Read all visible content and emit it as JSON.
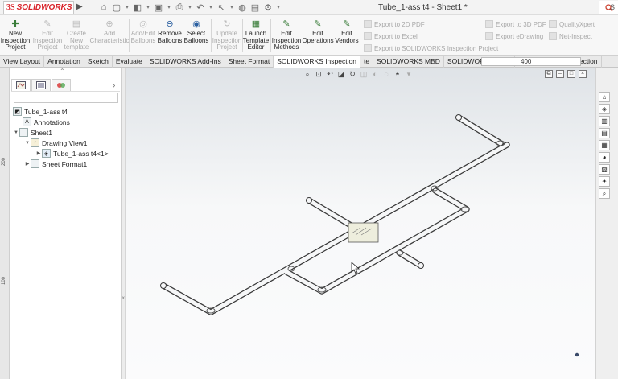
{
  "app": {
    "logo_prefix": "3S",
    "logo_name": "SOLIDWORKS",
    "document_title": "Tube_1-ass t4 - Sheet1 *",
    "right_label": "S"
  },
  "quick_access": {
    "icons": [
      "home-icon",
      "new-document-icon",
      "open-icon",
      "save-icon",
      "print-icon",
      "undo-icon",
      "select-icon",
      "rebuild-icon",
      "options-icon"
    ]
  },
  "ribbon": {
    "buttons": [
      {
        "label": "New Inspection Project",
        "lines": [
          "New",
          "Inspection",
          "Project"
        ],
        "enabled": true,
        "icon": "new-inspection-project-icon"
      },
      {
        "label": "Edit Inspection Project",
        "lines": [
          "Edit",
          "Inspection",
          "Project"
        ],
        "enabled": false,
        "icon": "edit-inspection-project-icon"
      },
      {
        "label": "Create New template",
        "lines": [
          "Create",
          "New",
          "template"
        ],
        "enabled": false,
        "icon": "create-template-icon"
      },
      {
        "label": "Add Characteristic",
        "lines": [
          "Add",
          "Characteristic"
        ],
        "enabled": false,
        "icon": "add-characteristic-icon"
      },
      {
        "label": "Add/Edit Balloons",
        "lines": [
          "Add/Edit",
          "Balloons"
        ],
        "enabled": false,
        "icon": "add-edit-balloons-icon"
      },
      {
        "label": "Remove Balloons",
        "lines": [
          "Remove",
          "Balloons"
        ],
        "enabled": true,
        "icon": "remove-balloons-icon"
      },
      {
        "label": "Select Balloons",
        "lines": [
          "Select",
          "Balloons"
        ],
        "enabled": true,
        "icon": "select-balloons-icon"
      },
      {
        "label": "Update Inspection Project",
        "lines": [
          "Update",
          "Inspection",
          "Project"
        ],
        "enabled": false,
        "icon": "update-inspection-project-icon"
      },
      {
        "label": "Launch Template Editor",
        "lines": [
          "Launch",
          "Template",
          "Editor"
        ],
        "enabled": true,
        "icon": "launch-template-editor-icon"
      },
      {
        "label": "Edit Inspection Methods",
        "lines": [
          "Edit",
          "Inspection",
          "Methods"
        ],
        "enabled": true,
        "icon": "edit-inspection-methods-icon"
      },
      {
        "label": "Edit Operations",
        "lines": [
          "Edit",
          "Operations"
        ],
        "enabled": true,
        "icon": "edit-operations-icon"
      },
      {
        "label": "Edit Vendors",
        "lines": [
          "Edit",
          "Vendors"
        ],
        "enabled": true,
        "icon": "edit-vendors-icon"
      }
    ],
    "export_items": [
      {
        "label": "Export to 2D PDF",
        "icon": "export-2d-pdf-icon"
      },
      {
        "label": "Export to Excel",
        "icon": "export-excel-icon"
      },
      {
        "label": "Export to SOLIDWORKS Inspection Project",
        "icon": "export-inspection-project-icon"
      },
      {
        "label": "Export to 3D PDF",
        "icon": "export-3d-pdf-icon"
      },
      {
        "label": "Export eDrawing",
        "icon": "export-edrawing-icon"
      },
      {
        "label": "QualityXpert",
        "icon": "qualityxpert-icon"
      },
      {
        "label": "Net-Inspect",
        "icon": "net-inspect-icon"
      }
    ]
  },
  "tabs": [
    {
      "label": "View Layout",
      "active": false
    },
    {
      "label": "Annotation",
      "active": false
    },
    {
      "label": "Sketch",
      "active": false
    },
    {
      "label": "Evaluate",
      "active": false
    },
    {
      "label": "SOLIDWORKS Add-Ins",
      "active": false
    },
    {
      "label": "Sheet Format",
      "active": false
    },
    {
      "label": "SOLIDWORKS Inspection",
      "active": true
    },
    {
      "label": "te",
      "active": false
    },
    {
      "label": "SOLIDWORKS MBD",
      "active": false
    },
    {
      "label": "SOLIDWORKS CAM",
      "active": false
    },
    {
      "label": "SOLIDWORKS Inspection",
      "active": false
    }
  ],
  "tab_field_value": "400",
  "ruler_marks": [
    "200",
    "100"
  ],
  "feature_tree": {
    "nodes": [
      {
        "label": "Tube_1-ass t4",
        "icon": "drawing-icon",
        "toggle": ""
      },
      {
        "label": "Annotations",
        "icon": "annotations-icon",
        "toggle": ""
      },
      {
        "label": "Sheet1",
        "icon": "sheet-icon",
        "toggle": "▼"
      },
      {
        "label": "Drawing View1",
        "icon": "drawing-view-icon",
        "toggle": "▼"
      },
      {
        "label": "Tube_1-ass t4<1>",
        "icon": "assembly-icon",
        "toggle": "▶"
      },
      {
        "label": "Sheet Format1",
        "icon": "sheet-format-icon",
        "toggle": "▶"
      }
    ]
  },
  "heads_up_toolbar": {
    "icons": [
      "zoom-to-fit-icon",
      "zoom-to-area-icon",
      "previous-view-icon",
      "section-view-icon",
      "rotate-icon",
      "view-orientation-icon",
      "display-style-icon",
      "hide-show-icon",
      "appearance-icon",
      "view-settings-icon"
    ]
  },
  "task_pane": {
    "icons": [
      "home-icon",
      "resources-icon",
      "design-library-icon",
      "file-explorer-icon",
      "view-palette-icon",
      "appearances-icon",
      "custom-properties-icon",
      "solidworks-forum-icon",
      "search-icon"
    ]
  },
  "colors": {
    "brand_red": "#d8232a",
    "ribbon_bg": "#f7f7f7",
    "canvas_top": "#dfe3e7",
    "canvas_bottom": "#fbfbfc",
    "tube_fill": "#f6f7f8",
    "tube_outline": "#3a3a3a",
    "balloon_box": "#eeeedd"
  }
}
